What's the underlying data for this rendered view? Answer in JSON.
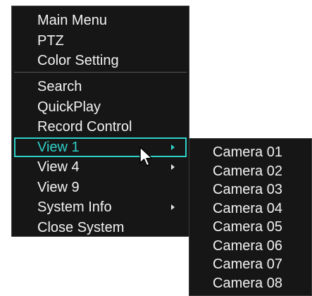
{
  "main_menu": {
    "group1": [
      {
        "label": "Main Menu",
        "submenu": false
      },
      {
        "label": "PTZ",
        "submenu": false
      },
      {
        "label": "Color Setting",
        "submenu": false
      }
    ],
    "group2": [
      {
        "label": "Search",
        "submenu": false
      },
      {
        "label": "QuickPlay",
        "submenu": false
      },
      {
        "label": "Record Control",
        "submenu": false
      },
      {
        "label": "View 1",
        "submenu": true,
        "selected": true
      },
      {
        "label": "View 4",
        "submenu": true
      },
      {
        "label": "View 9",
        "submenu": false
      },
      {
        "label": "System Info",
        "submenu": true
      },
      {
        "label": "Close System",
        "submenu": false
      }
    ]
  },
  "view1_submenu": {
    "items": [
      {
        "label": "Camera 01"
      },
      {
        "label": "Camera 02"
      },
      {
        "label": "Camera 03"
      },
      {
        "label": "Camera 04"
      },
      {
        "label": "Camera 05"
      },
      {
        "label": "Camera 06"
      },
      {
        "label": "Camera 07"
      },
      {
        "label": "Camera 08"
      }
    ]
  },
  "colors": {
    "menu_background": "#161616",
    "text": "#f2f2f2",
    "selection_accent": "#2fd0c8"
  },
  "icons": {
    "submenu_arrow": "triangle-right-icon",
    "cursor": "mouse-pointer-icon"
  }
}
